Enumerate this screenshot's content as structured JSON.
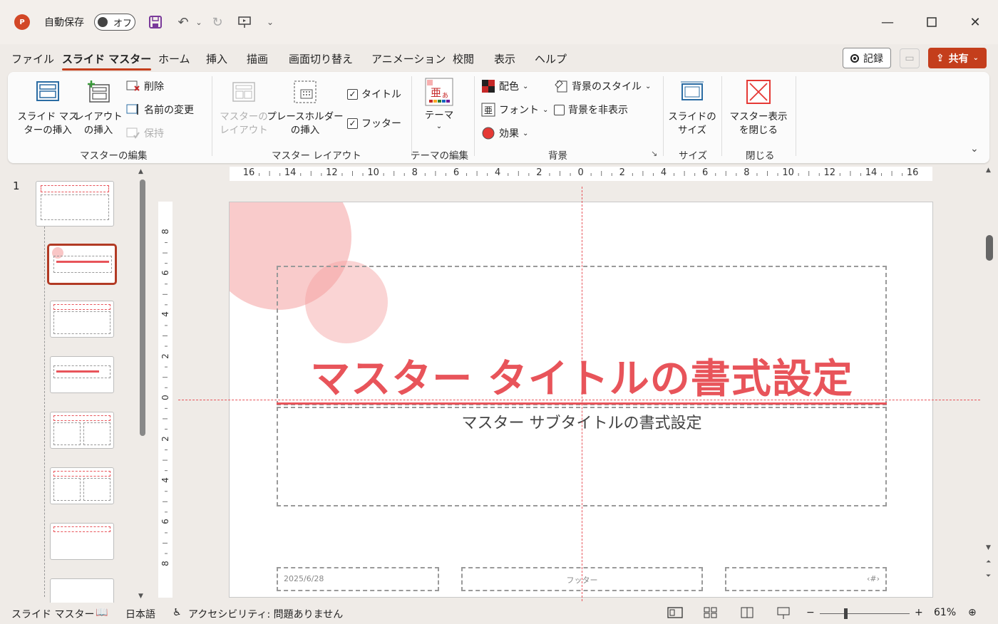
{
  "app": {
    "autosave_label": "自動保存",
    "autosave_state": "オフ",
    "brand_color": "#c43e1c"
  },
  "tabs": [
    "ファイル",
    "スライド マスター",
    "ホーム",
    "挿入",
    "描画",
    "画面切り替え",
    "アニメーション",
    "校閲",
    "表示",
    "ヘルプ"
  ],
  "tab_active": "スライド マスター",
  "topright": {
    "record": "記録",
    "share": "共有"
  },
  "ribbon": {
    "insert_master": "スライド マス\nターの挿入",
    "insert_layout": "レイアウト\nの挿入",
    "delete": "削除",
    "rename": "名前の変更",
    "preserve": "保持",
    "group_master_edit": "マスターの編集",
    "master_layout": "マスターの\nレイアウト",
    "insert_placeholder": "プレースホルダー\nの挿入",
    "title_check": "タイトル",
    "footer_check": "フッター",
    "group_master_layout": "マスター レイアウト",
    "theme": "テーマ",
    "group_theme_edit": "テーマの編集",
    "colors": "配色",
    "fonts": "フォント",
    "effects": "効果",
    "bg_styles": "背景のスタイル",
    "hide_bg": "背景を非表示",
    "group_background": "背景",
    "slide_size": "スライドの\nサイズ",
    "group_size": "サイズ",
    "close_master": "マスター表示\nを閉じる",
    "group_close": "閉じる"
  },
  "thumbnails": {
    "slide_number": "1"
  },
  "ruler": {
    "h_ticks": [
      "16",
      "14",
      "12",
      "10",
      "8",
      "6",
      "4",
      "2",
      "0",
      "2",
      "4",
      "6",
      "8",
      "10",
      "12",
      "14",
      "16"
    ],
    "v_ticks": [
      "8",
      "6",
      "4",
      "2",
      "0",
      "2",
      "4",
      "6",
      "8"
    ]
  },
  "slide": {
    "title": "マスター タイトルの書式設定",
    "subtitle": "マスター サブタイトルの書式設定",
    "date": "2025/6/28",
    "footer": "フッター",
    "page_no": "‹#›",
    "accent_color": "#e8545a"
  },
  "status": {
    "view": "スライド マスター",
    "language": "日本語",
    "accessibility": "アクセシビリティ: 問題ありません",
    "zoom_minus": "−",
    "zoom_plus": "+",
    "zoom": "61%"
  }
}
